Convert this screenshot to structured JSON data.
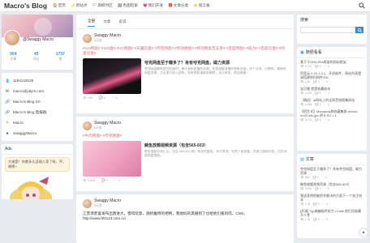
{
  "site": {
    "title": "Macro's Blog"
  },
  "nav": [
    {
      "icon": "home-icon",
      "glyph": "🏠",
      "label": "首页"
    },
    {
      "icon": "discover-icon",
      "glyph": "✨",
      "label": "新站点"
    },
    {
      "icon": "flag-icon",
      "glyph": "🏳",
      "label": "旗帜时区"
    },
    {
      "icon": "image-icon",
      "glyph": "🖼",
      "label": "色图检索"
    },
    {
      "icon": "heart-icon",
      "glyph": "💗",
      "label": "我们开发"
    },
    {
      "icon": "gift-icon",
      "glyph": "🎁",
      "label": "文章分类"
    },
    {
      "icon": "star-icon",
      "glyph": "⭐",
      "label": "留言板"
    }
  ],
  "profile": {
    "name": "@Swaggy Macro",
    "stats": [
      {
        "value": "504",
        "label": "文章"
      },
      {
        "value": "45",
        "label": "评论"
      },
      {
        "value": "1737",
        "label": "赞"
      }
    ]
  },
  "links": [
    {
      "icon": "qq-icon",
      "glyph": "💧",
      "label": "1194142028"
    },
    {
      "icon": "mail-icon",
      "glyph": "✉",
      "label": "macro@jalym.com"
    },
    {
      "icon": "link-icon",
      "glyph": "🔗",
      "label": "Macro's Blog SC"
    },
    {
      "icon": "link-icon",
      "glyph": "🔗",
      "label": "Macro's Blog 电报群"
    },
    {
      "icon": "weibo-icon",
      "glyph": "⚘",
      "label": "Macro"
    },
    {
      "icon": "github-icon",
      "glyph": "●",
      "label": "SwaggyMacro"
    }
  ],
  "ads": {
    "title": "Ads",
    "bubble": "大佬是！你都多久没理人家了呀，哼，哪嗯~"
  },
  "tabs": [
    {
      "label": "全部",
      "active": true
    },
    {
      "label": "文章",
      "active": false
    },
    {
      "label": "说说",
      "active": false
    }
  ],
  "posts": [
    {
      "author": "Swaggy Macro",
      "date": "8天前",
      "tags": "#115网盘# #123盘# #UC网盘# #天翼云盘# #夸克网盘# #移动硬盘# #移动网盘百五亩# #百度网盘# #威力# #百度云盘# #阿里云盘#",
      "title": "夸克网盘至于赚多了？肯有夸克网盘，磁力资源",
      "desc": "夸克网盘最新提交的福利！每天更新直播的资源，免费观看直播的更新资源，多个分类、日期等，最新的网盘资源，点击即可进入获取，如有侵权请联系删除，永久有效，欢迎收藏！",
      "views": "408",
      "comments": "0",
      "likes": "0",
      "thumb": "thumb1"
    },
    {
      "author": "Swaggy Macro",
      "date": "8天前",
      "tags": "#牛肉网盘# #夸克网盘#",
      "title": "鲸鱼放题视频资源（包含565-603）",
      "desc": "鲸鱼放题资源汇总，包含 565-603 期，高清完整版，永久有效，免费下载观看，资源已整理分类，点击获取网盘链接。",
      "views": "9.60k",
      "comments": "0",
      "likes": "0",
      "thumb": "thumb2"
    },
    {
      "author": "Swaggy Macro",
      "date": "8天前",
      "text": "江苏添老喜发布出跑进大，傻得玩意，随机推特的把柄，我他妈的黑播到了也给他们看的肉，ChM，http://www.bl2123.com.cc/"
    }
  ],
  "sidebar": {
    "search_title": "搜索",
    "search_placeholder": "",
    "hot_title": "随便看看",
    "hot": [
      {
        "title": "基于汗OROJRA框架的网站框架",
        "views": "1.07k",
        "c": "0",
        "l": "0"
      },
      {
        "title": "阿里云 2.19-1.3.1，开机软件，网站列表登录搭建到时网件20k",
        "views": "2.6k",
        "c": "0",
        "l": "0"
      },
      {
        "title": "宝贝猫 就是收藏剧本",
        "views": "3.75k",
        "c": "0",
        "l": "0"
      },
      {
        "title": "（随机）ai网站上的全网音效图集网站",
        "views": "4.18k",
        "c": "0",
        "l": "0"
      },
      {
        "title": "【招生式】Monopoly和收藏集群 stimux-ic100-elf-gcc-阴卡卡2.1.1",
        "views": "10.2k",
        "c": "0",
        "l": "0"
      }
    ],
    "art_title": "文章",
    "arts": [
      {
        "title": "夸克网盘至于赚多了？肯有夸克网盘，磁力资源",
        "views": "408",
        "c": "0",
        "l": "0"
      },
      {
        "title": "鲸鱼放题视频资源（包含565-603）",
        "views": "9.60k",
        "c": "0",
        "l": "0"
      },
      {
        "title": "我这家得他能把并解决的方面下一个关注站本",
        "views": "1.3k",
        "c": "0",
        "l": "0"
      },
      {
        "title": "[开源] Typ缩编插件助力 | Lotte 他们用收藏不人等",
        "views": "1.4k",
        "c": "0",
        "l": "0"
      }
    ]
  }
}
